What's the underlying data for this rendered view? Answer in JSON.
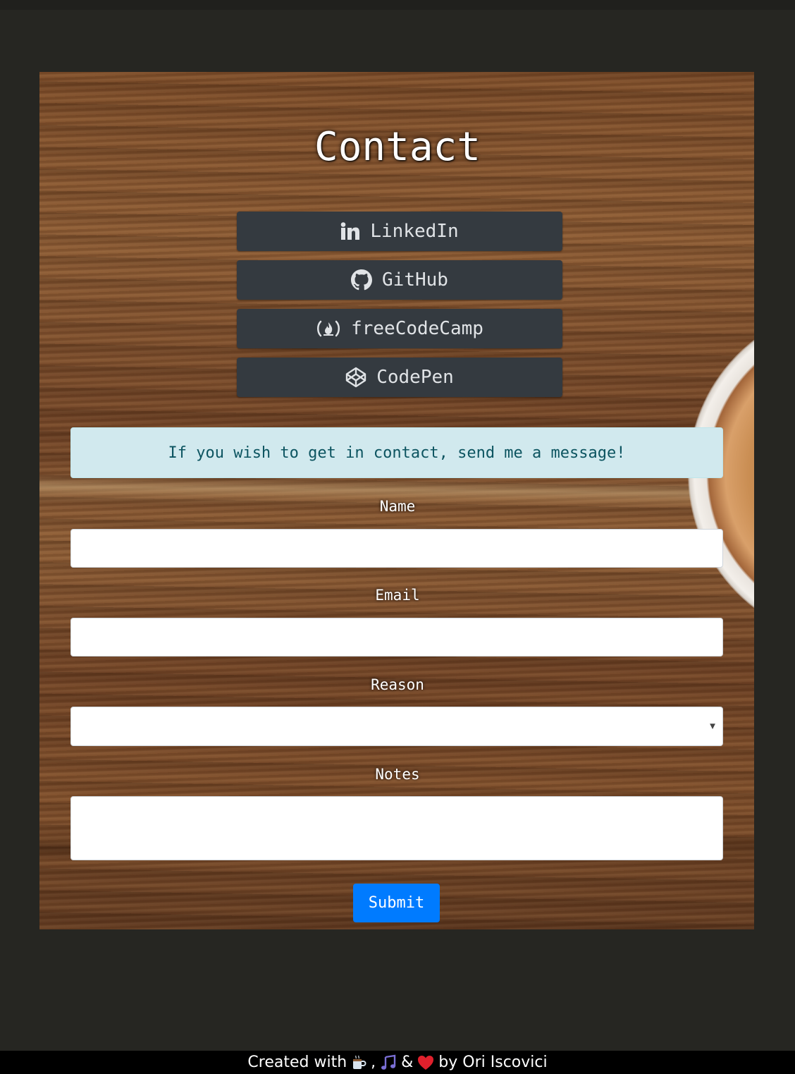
{
  "page": {
    "title": "Contact"
  },
  "social": [
    {
      "label": "LinkedIn",
      "icon": "linkedin-icon"
    },
    {
      "label": "GitHub",
      "icon": "github-icon"
    },
    {
      "label": "freeCodeCamp",
      "icon": "freecodecamp-icon"
    },
    {
      "label": "CodePen",
      "icon": "codepen-icon"
    }
  ],
  "alert": {
    "message": "If you wish to get in contact, send me a message!"
  },
  "form": {
    "name_label": "Name",
    "name_value": "",
    "email_label": "Email",
    "email_value": "",
    "reason_label": "Reason",
    "reason_value": "",
    "notes_label": "Notes",
    "notes_value": "",
    "submit_label": "Submit"
  },
  "footer": {
    "prefix": "Created with",
    "comma": ",",
    "amp": "&",
    "suffix": "by Ori Iscovici",
    "icons": [
      "coffee-icon",
      "music-note-icon",
      "heart-icon"
    ]
  },
  "colors": {
    "page_background": "#262622",
    "social_button": "#343a40",
    "alert_background": "#d1e9ee",
    "alert_text": "#0c5460",
    "submit_button": "#007bff",
    "footer_background": "#000000"
  }
}
